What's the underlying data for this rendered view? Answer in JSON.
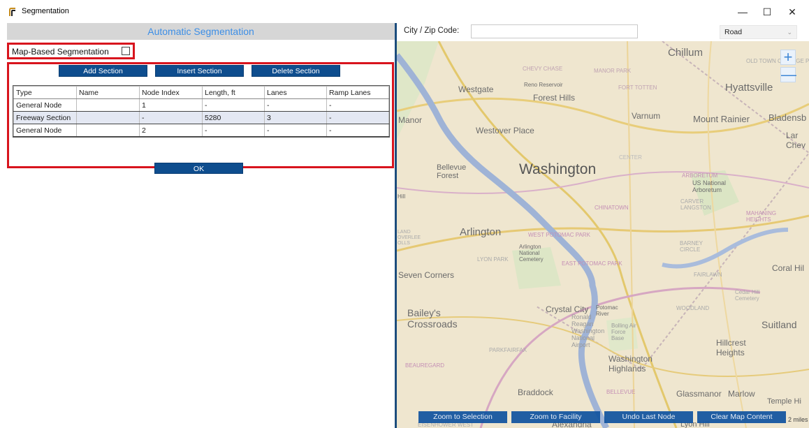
{
  "window": {
    "title": "Segmentation",
    "controls": {
      "minimize": "—",
      "maximize": "☐",
      "close": "✕"
    }
  },
  "left_panel": {
    "header": "Automatic Segmentation",
    "map_based_label": "Map-Based Segmentation",
    "map_based_checked": false,
    "buttons": {
      "add": "Add Section",
      "insert": "Insert Section",
      "delete": "Delete Section",
      "ok": "OK"
    },
    "table": {
      "columns": [
        "Type",
        "Name",
        "Node Index",
        "Length, ft",
        "Lanes",
        "Ramp Lanes"
      ],
      "rows": [
        [
          "General Node",
          "",
          "1",
          "-",
          "-",
          "-"
        ],
        [
          "Freeway Section",
          "",
          "-",
          "5280",
          "3",
          "-"
        ],
        [
          "General Node",
          "",
          "2",
          "-",
          "-",
          "-"
        ]
      ]
    }
  },
  "right_panel": {
    "city_label": "City / Zip Code:",
    "city_value": "",
    "map_style": "Road",
    "zoom_in": "+",
    "zoom_out": "—",
    "map_buttons": {
      "zoom_selection": "Zoom to Selection",
      "zoom_facility": "Zoom to Facility",
      "undo_last": "Undo Last Node",
      "clear_map": "Clear Map Content"
    },
    "scale": "2 miles",
    "map_labels": {
      "washington": "Washington",
      "arlington": "Arlington",
      "hyattsville": "Hyattsville",
      "chillum": "Chillum",
      "westgate": "Westgate",
      "forest_hills": "Forest Hills",
      "varnum": "Varnum",
      "mount_rainier": "Mount Rainier",
      "bladensburg": "Bladensb",
      "westover_place": "Westover Place",
      "bellevue_forest": "Bellevue Forest",
      "seven_corners": "Seven Corners",
      "baileys": "Bailey's Crossroads",
      "crystal_city": "Crystal City",
      "suitland": "Suitland",
      "hillcrest": "Hillcrest Heights",
      "washington_highlands": "Washington Highlands",
      "braddock": "Braddock",
      "glassmanor": "Glassmanor",
      "marlow": "Marlow",
      "coral_hill": "Coral Hil",
      "chevy_chase": "CHEVY CHASE",
      "manor_park": "MANOR PARK",
      "fort_totten": "FORT TOTTEN",
      "chinatown": "CHINATOWN",
      "west_potomac": "WEST POTOMAC PARK",
      "east_potomac": "EAST POTOMAC PARK",
      "arboretum": "ARBORETUM",
      "us_arboretum": "US National Arboretum",
      "carver": "CARVER LANGSTON",
      "woodland": "WOODLAND",
      "lyon_park": "LYON PARK",
      "parkfairfax": "PARKFAIRFAX",
      "beauregard": "BEAUREGARD",
      "arlington_cemetery": "Arlington National Cemetery",
      "reagan": "Ronald Reagan Washington National Airport",
      "bolling": "Bolling Air Force Base",
      "fairlawn": "FAIRLAWN",
      "center": "CENTER",
      "barney_circle": "BARNEY CIRCLE",
      "mahaning": "MAHANING HEIGHTS",
      "potomac_river": "Potomac River",
      "alexandria": "Alexandria",
      "manor": "Manor",
      "hill": "Hill",
      "cedar_hill": "Cedar Hill Cemetery",
      "reno": "Reno Reservoir",
      "old_town": "OLD TOWN COLLEGE PA",
      "lan": "Lar Chev",
      "land_overlee": "LAND OVERLEE OLLS",
      "temple": "Temple Hi",
      "eisenhower": "EISENHOWER WEST",
      "lyon_hill": "Lyon Hill",
      "bellevue": "BELLEVUE"
    }
  }
}
